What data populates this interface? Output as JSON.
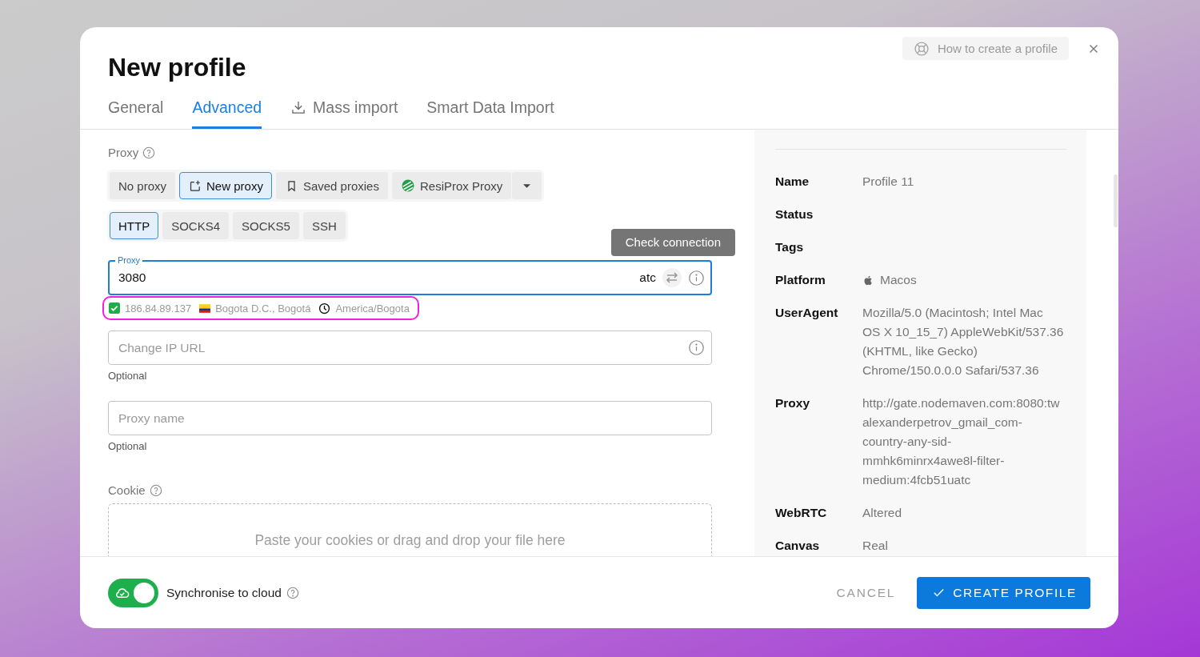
{
  "dialog": {
    "title": "New profile",
    "help_button": "How to create a profile"
  },
  "tabs": [
    {
      "label": "General",
      "selected": false,
      "kind": "plain"
    },
    {
      "label": "Advanced",
      "selected": true,
      "kind": "plain"
    },
    {
      "label": "Mass import",
      "selected": false,
      "kind": "import"
    },
    {
      "label": "Smart Data Import",
      "selected": false,
      "kind": "plain"
    }
  ],
  "proxy": {
    "label": "Proxy",
    "modes": [
      {
        "label": "No proxy",
        "selected": false,
        "kind": "plain"
      },
      {
        "label": "New proxy",
        "selected": true,
        "kind": "new"
      },
      {
        "label": "Saved proxies",
        "selected": false,
        "kind": "saved"
      },
      {
        "label": "ResiProx Proxy",
        "selected": false,
        "kind": "provider"
      }
    ],
    "protocols": [
      {
        "label": "HTTP",
        "selected": true
      },
      {
        "label": "SOCKS4",
        "selected": false
      },
      {
        "label": "SOCKS5",
        "selected": false
      },
      {
        "label": "SSH",
        "selected": false
      }
    ],
    "tooltip": "Check connection",
    "field": {
      "label": "Proxy",
      "value": "3080",
      "value_end": "atc",
      "focused": true
    },
    "check": {
      "verified": true,
      "highlighted": true,
      "ip": "186.84.89.137",
      "location": "Bogota D.C., Bogotá",
      "timezone": "America/Bogota"
    },
    "change_ip": {
      "placeholder": "Change IP URL",
      "helper": "Optional"
    },
    "name": {
      "placeholder": "Proxy name",
      "helper": "Optional"
    }
  },
  "cookie": {
    "label": "Cookie",
    "placeholder": "Paste your cookies or drag and drop your file here"
  },
  "summary": {
    "rows": [
      {
        "label": "Name",
        "value": "Profile 11",
        "kind": "text"
      },
      {
        "label": "Status",
        "kind": "text"
      },
      {
        "label": "Tags",
        "kind": "text"
      },
      {
        "label": "Platform",
        "value": "Macos",
        "kind": "platform"
      },
      {
        "label": "UserAgent",
        "value": "Mozilla/5.0 (Macintosh; Intel Mac OS X 10_15_7) AppleWebKit/537.36 (KHTML, like Gecko) Chrome/150.0.0.0 Safari/537.36",
        "kind": "text"
      },
      {
        "label": "Proxy",
        "value": "http://gate.nodemaven.com:8080:twalexanderpetrov_gmail_com-country-any-sid-mmhk6minrx4awe8l-filter-medium:4fcb51uatc",
        "kind": "text"
      },
      {
        "label": "WebRTC",
        "value": "Altered",
        "kind": "text"
      },
      {
        "label": "Canvas",
        "value": "Real",
        "kind": "text"
      }
    ]
  },
  "footer": {
    "sync": {
      "label": "Synchronise to cloud",
      "on": true
    },
    "buttons": [
      {
        "label": "CANCEL",
        "kind": "text"
      },
      {
        "label": "CREATE PROFILE",
        "kind": "primary"
      }
    ]
  }
}
